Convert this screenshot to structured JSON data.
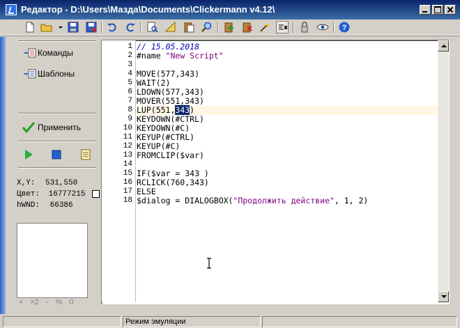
{
  "window": {
    "title": "Редактор - D:\\Users\\Мазда\\Documents\\Clickermann v4.12\\"
  },
  "toolbar": {
    "buttons": [
      {
        "name": "new-file-icon"
      },
      {
        "name": "open-folder-icon"
      },
      {
        "name": "open-dropdown-icon"
      },
      {
        "name": "save-icon"
      },
      {
        "name": "save-as-icon"
      },
      {
        "name": "undo-icon"
      },
      {
        "name": "redo-icon"
      },
      {
        "name": "find-icon"
      },
      {
        "name": "ruler-icon"
      },
      {
        "name": "paste-special-icon"
      },
      {
        "name": "search-icon"
      },
      {
        "name": "insert-icon"
      },
      {
        "name": "delete-icon"
      },
      {
        "name": "magic-wand-icon"
      },
      {
        "name": "toggle-view-icon"
      },
      {
        "name": "lock-icon"
      },
      {
        "name": "eye-icon"
      },
      {
        "name": "help-icon"
      }
    ]
  },
  "sidebar": {
    "commands_label": "Команды",
    "templates_label": "Шаблоны",
    "apply_label": "Применить"
  },
  "info": {
    "xy_label": "X,Y:",
    "xy_value": "531,550",
    "color_label": "Цвет:",
    "color_value": "16777215",
    "hwnd_label": "hWND:",
    "hwnd_value": "66386"
  },
  "zoom": {
    "plus": "+",
    "x2": "×2",
    "minus": "-",
    "percent": "%",
    "zero": "0"
  },
  "editor": {
    "lines": [
      "1",
      "2",
      "3",
      "4",
      "5",
      "6",
      "7",
      "8",
      "9",
      "10",
      "11",
      "12",
      "13",
      "14",
      "15",
      "16",
      "17",
      "18"
    ],
    "code": {
      "l1": "// 15.05.2018",
      "l2a": "#name ",
      "l2b": "\"New Script\"",
      "l4": "MOVE(577,343)",
      "l5": "WAIT(2)",
      "l6": "LDOWN(577,343)",
      "l7": "MOVER(551,343)",
      "l8a": "LUP(551,",
      "l8b": "343",
      "l8c": ")",
      "l9": "KEYDOWN(#CTRL)",
      "l10": "KEYDOWN(#C)",
      "l11": "KEYUP(#CTRL)",
      "l12": "KEYUP(#C)",
      "l13": "FROMCLIP($var)",
      "l15": "IF($var = 343 )",
      "l16": "RCLICK(760,343)",
      "l17": "ELSE",
      "l18a": "$dialog = DIALOGBOX(",
      "l18b": "\"Продолжить действие\"",
      "l18c": ", 1, 2)"
    }
  },
  "status": {
    "panel1": "",
    "panel2": "Режим эмуляции",
    "panel3": ""
  },
  "colors": {
    "titlebar": "#0a246a",
    "selection": "#0a246a",
    "current_line": "#fff7e4",
    "comment": "#0000c0",
    "string": "#800080"
  }
}
